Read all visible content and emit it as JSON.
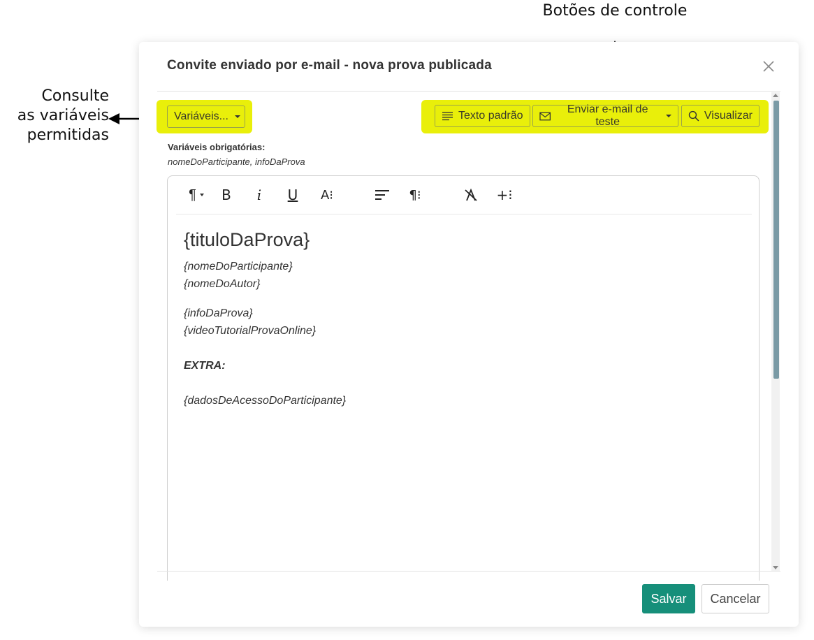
{
  "annotations": {
    "top": "Botões de controle",
    "left_line1": "Consulte",
    "left_line2": "as variáveis",
    "left_line3": "permitidas"
  },
  "modal": {
    "title": "Convite enviado por e-mail - nova prova publicada",
    "close_icon": "close-icon"
  },
  "controls": {
    "variables_label": "Variáveis...",
    "default_text_label": "Texto padrão",
    "send_test_label": "Enviar e-mail de teste",
    "preview_label": "Visualizar"
  },
  "required": {
    "label": "Variáveis obrigatórias:",
    "list": "nomeDoParticipante, infoDaProva"
  },
  "toolbar": {
    "paragraph": "¶",
    "bold": "B",
    "italic": "i",
    "underline": "U",
    "font_size": "A⁝",
    "align": "align-icon",
    "paragraph_format": "¶⁝",
    "clear_format": "clear-format-icon",
    "insert": "+⁝"
  },
  "content": {
    "title": "{tituloDaProva}",
    "line1": "{nomeDoParticipante}",
    "line2": "{nomeDoAutor}",
    "line3": "{infoDaProva}",
    "line4": "{videoTutorialProvaOnline}",
    "extra": "EXTRA:",
    "line5": "{dadosDeAcessoDoParticipante}"
  },
  "footer": {
    "save_label": "Salvar",
    "cancel_label": "Cancelar"
  },
  "colors": {
    "highlight": "#e9ef0a",
    "save_button": "#168f7a",
    "scroll_thumb": "#7a9aa5"
  }
}
